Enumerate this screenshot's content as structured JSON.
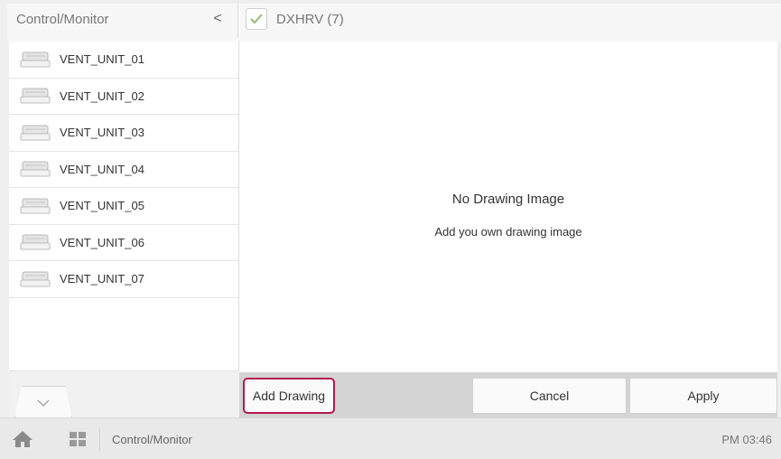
{
  "header": {
    "section_title": "Control/Monitor",
    "collapse_glyph": "<",
    "group_title": "DXHRV (7)"
  },
  "sidebar": {
    "items": [
      {
        "label": "VENT_UNIT_01",
        "icon": "ventilation-unit-icon"
      },
      {
        "label": "VENT_UNIT_02",
        "icon": "ventilation-unit-icon"
      },
      {
        "label": "VENT_UNIT_03",
        "icon": "ventilation-unit-icon"
      },
      {
        "label": "VENT_UNIT_04",
        "icon": "ventilation-unit-icon"
      },
      {
        "label": "VENT_UNIT_05",
        "icon": "ventilation-unit-icon"
      },
      {
        "label": "VENT_UNIT_06",
        "icon": "ventilation-unit-icon"
      },
      {
        "label": "VENT_UNIT_07",
        "icon": "ventilation-unit-icon"
      }
    ]
  },
  "content": {
    "empty_title": "No Drawing Image",
    "empty_subtitle": "Add you own drawing image"
  },
  "actions": {
    "add_drawing": "Add Drawing",
    "cancel": "Cancel",
    "apply": "Apply"
  },
  "bottom_bar": {
    "title": "Control/Monitor",
    "time": "PM 03:46"
  },
  "colors": {
    "highlight_border": "#b2194b",
    "check_mark": "#7aa04a"
  }
}
